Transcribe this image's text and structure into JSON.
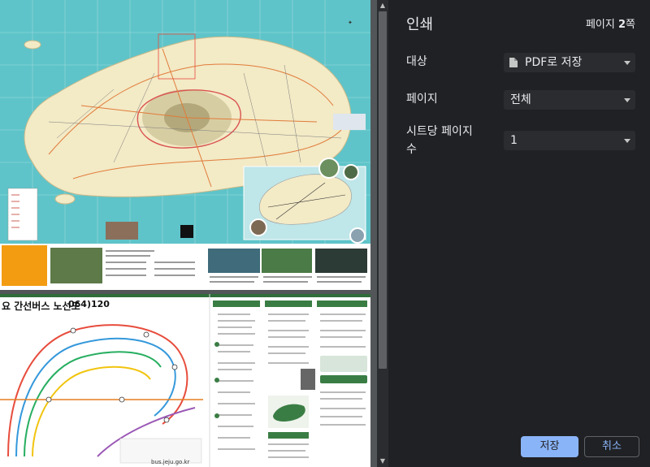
{
  "panel": {
    "title": "인쇄",
    "page_count_prefix": "페이지 ",
    "page_count_value": "2",
    "page_count_suffix": "쪽",
    "destination_label": "대상",
    "destination_value": "PDF로 저장",
    "pages_label": "페이지",
    "pages_value": "전체",
    "per_sheet_label_line1": "시트당 페이지",
    "per_sheet_label_line2": "수",
    "per_sheet_value": "1",
    "save_button": "저장",
    "cancel_button": "취소"
  },
  "preview": {
    "page2_heading": "요 간선버스 노선도",
    "page2_phone": "064)120",
    "page2_site": "bus.jeju.go.kr"
  },
  "colors": {
    "panel_bg": "#202124",
    "accent": "#8ab4f8",
    "sea": "#5ec4c9",
    "land": "#f3eac6"
  },
  "icons": {
    "destination": "document-icon",
    "dropdown": "caret-down-icon"
  }
}
